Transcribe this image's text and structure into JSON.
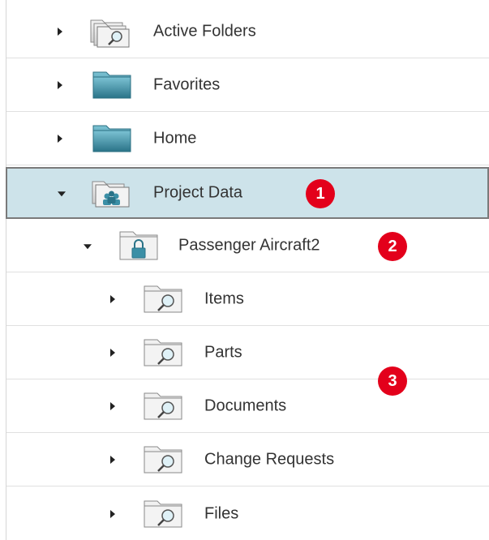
{
  "tree": {
    "items": [
      {
        "label": "Active Folders",
        "icon": "search-folder-stack-icon",
        "expanded": false
      },
      {
        "label": "Favorites",
        "icon": "folder-icon",
        "expanded": false
      },
      {
        "label": "Home",
        "icon": "folder-icon",
        "expanded": false
      },
      {
        "label": "Project Data",
        "icon": "project-folder-icon",
        "expanded": true,
        "selected": true
      },
      {
        "label": "Passenger Aircraft2",
        "icon": "locked-folder-icon",
        "expanded": true
      },
      {
        "label": "Items",
        "icon": "search-folder-icon",
        "expanded": false
      },
      {
        "label": "Parts",
        "icon": "search-folder-icon",
        "expanded": false
      },
      {
        "label": "Documents",
        "icon": "search-folder-icon",
        "expanded": false
      },
      {
        "label": "Change Requests",
        "icon": "search-folder-icon",
        "expanded": false
      },
      {
        "label": "Files",
        "icon": "search-folder-icon",
        "expanded": false
      }
    ]
  },
  "callouts": [
    "1",
    "2",
    "3"
  ],
  "colors": {
    "selection_bg": "#cde3ea",
    "badge": "#e3001b",
    "folder_teal": "#3b8fa6"
  }
}
